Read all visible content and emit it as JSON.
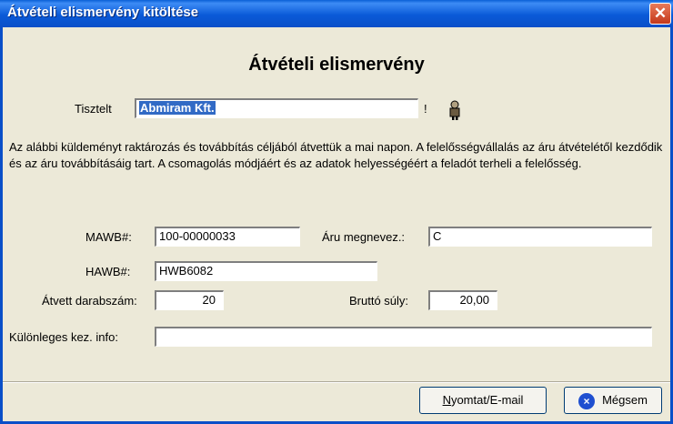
{
  "window": {
    "title": "Átvételi elismervény kitöltése",
    "close_label": "✕"
  },
  "form": {
    "heading": "Átvételi elismervény",
    "greeting_label": "Tisztelt",
    "recipient_value": "Abmiram Kft.",
    "exclamation": "!",
    "paragraph": "Az alábbi küldeményt raktározás és továbbítás céljából átvettük a mai napon. A felelősségvállalás az áru átvételétől kezdődik és az áru továbbításáig tart. A csomagolás módjáért és az adatok helyességéért a feladót terheli a felelősség.",
    "mawb_label": "MAWB#:",
    "mawb_value": "100-00000033",
    "goods_label": "Áru megnevez.:",
    "goods_value": "C",
    "hawb_label": "HAWB#:",
    "hawb_value": "HWB6082",
    "pieces_label": "Átvett darabszám:",
    "pieces_value": "20",
    "weight_label": "Bruttó súly:",
    "weight_value": "20,00",
    "special_label": "Különleges kez. info:",
    "special_value": ""
  },
  "buttons": {
    "print_label": "Nyomtat/E-mail",
    "print_accel": "N",
    "print_rest": "yomtat/E-mail",
    "cancel_label": "Mégsem",
    "cancel_icon": "x-circle-icon"
  },
  "colors": {
    "title_bar": "#0a5ad8",
    "window_bg": "#ece9d8",
    "selection": "#316ac5"
  }
}
